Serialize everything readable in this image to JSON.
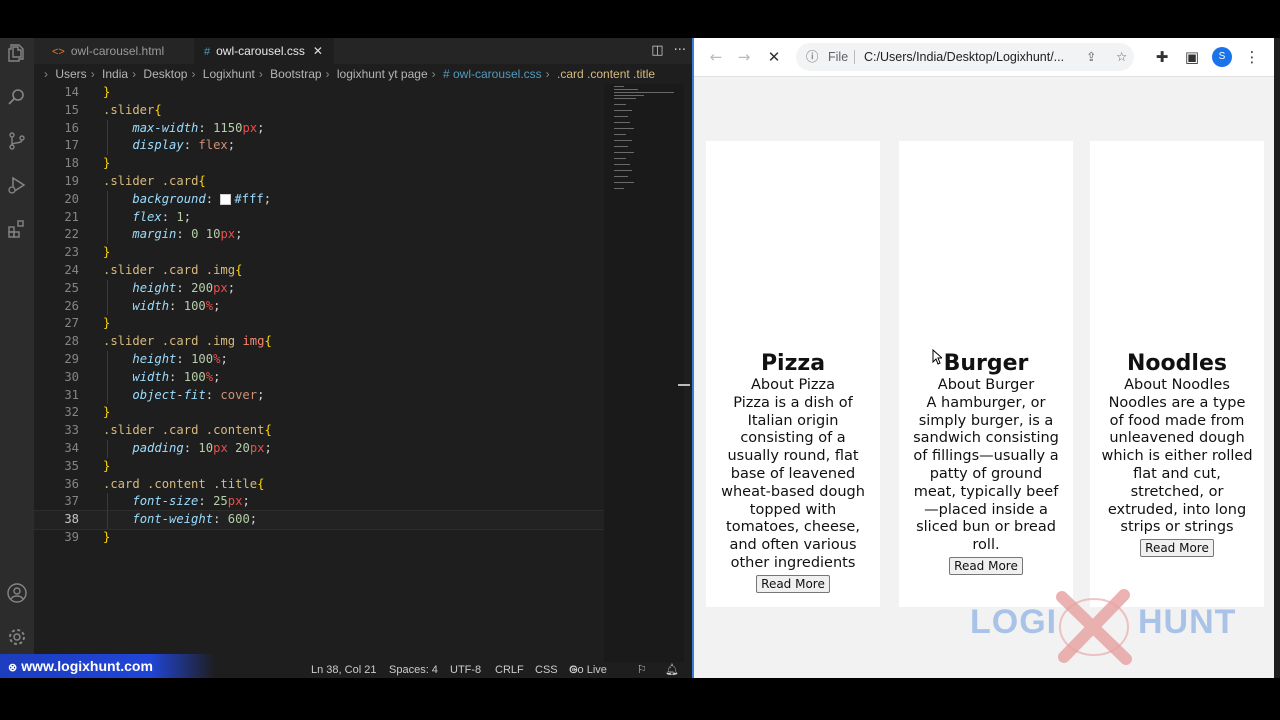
{
  "editor": {
    "tabs": [
      {
        "icon": "<>",
        "label": "owl-carousel.html"
      },
      {
        "icon": "#",
        "label": "owl-carousel.css"
      }
    ],
    "close": "✕",
    "breadcrumb": [
      "Users",
      "India",
      "Desktop",
      "Logixhunt",
      "Bootstrap",
      "logixhunt yt page",
      "# owl-carousel.css",
      ".card .content .title"
    ],
    "lines": [
      {
        "n": "14",
        "text": "}"
      },
      {
        "n": "15",
        "text": ".slider{"
      },
      {
        "n": "16",
        "text": "max-width: 1150px;"
      },
      {
        "n": "17",
        "text": "display: flex;"
      },
      {
        "n": "18",
        "text": "}"
      },
      {
        "n": "19",
        "text": ".slider .card{"
      },
      {
        "n": "20",
        "text": "background: #fff;"
      },
      {
        "n": "21",
        "text": "flex: 1;"
      },
      {
        "n": "22",
        "text": "margin: 0 10px;"
      },
      {
        "n": "23",
        "text": "}"
      },
      {
        "n": "24",
        "text": ".slider .card .img{"
      },
      {
        "n": "25",
        "text": "height: 200px;"
      },
      {
        "n": "26",
        "text": "width: 100%;"
      },
      {
        "n": "27",
        "text": "}"
      },
      {
        "n": "28",
        "text": ".slider .card .img img{"
      },
      {
        "n": "29",
        "text": "height: 100%;"
      },
      {
        "n": "30",
        "text": "width: 100%;"
      },
      {
        "n": "31",
        "text": "object-fit: cover;"
      },
      {
        "n": "32",
        "text": "}"
      },
      {
        "n": "33",
        "text": ".slider .card .content{"
      },
      {
        "n": "34",
        "text": "padding: 10px 20px;"
      },
      {
        "n": "35",
        "text": "}"
      },
      {
        "n": "36",
        "text": ".card .content .title{"
      },
      {
        "n": "37",
        "text": "font-size: 25px;"
      },
      {
        "n": "38",
        "text": "font-weight: 600;"
      },
      {
        "n": "39",
        "text": "}"
      }
    ],
    "current_line": "38",
    "status": {
      "cursor": "Ln 38, Col 21",
      "spaces": "Spaces: 4",
      "encoding": "UTF-8",
      "eol": "CRLF",
      "language": "CSS",
      "golive": "Go Live"
    },
    "watermark": "www.logixhunt.com"
  },
  "browser": {
    "file_label": "File",
    "url": "C:/Users/India/Desktop/Logixhunt/...",
    "profile_initial": "S",
    "cards": [
      {
        "title": "Pizza",
        "about": "About Pizza",
        "desc": "Pizza is a dish of Italian origin consisting of a usually round, flat base of leavened wheat-based dough topped with tomatoes, cheese, and often various other ingredients",
        "button": "Read More"
      },
      {
        "title": "Burger",
        "about": "About Burger",
        "desc": "A hamburger, or simply burger, is a sandwich consisting of fillings—usually a patty of ground meat, typically beef—placed inside a sliced bun or bread roll.",
        "button": "Read More"
      },
      {
        "title": "Noodles",
        "about": "About Noodles",
        "desc": "Noodles are a type of food made from unleavened dough which is either rolled flat and cut, stretched, or extruded, into long strips or strings",
        "button": "Read More"
      }
    ],
    "logo": {
      "left": "LOGI",
      "right": "HUNT"
    }
  },
  "colors": {
    "accent": "#1a73e8",
    "watermark_bg": "#2145d6",
    "logo": "#a9c3e8",
    "logo_x": "#e57373"
  }
}
